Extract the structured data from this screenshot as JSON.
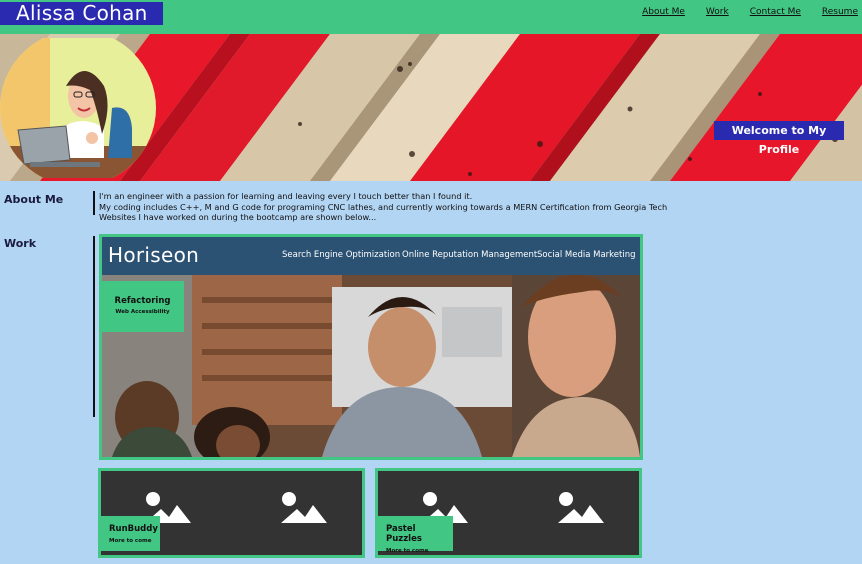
{
  "header": {
    "name": "Alissa Cohan",
    "nav": [
      "About Me",
      "Work",
      "Contact Me",
      "Resume"
    ]
  },
  "hero": {
    "welcome": "Welcome to My Profile"
  },
  "about": {
    "label": "About Me",
    "lines": [
      "I'm an engineer with a passion for learning and leaving every I touch better than I found it.",
      "My coding includes C++, M and G code for programing CNC lathes, and currently working towards a MERN Certification from Georgia Tech",
      "Websites I have worked on during the bootcamp are shown below..."
    ]
  },
  "work": {
    "label": "Work",
    "featured": {
      "site_logo": "Horiseon",
      "site_nav": [
        "Search Engine Optimization",
        "Online Reputation Management",
        "Social Media Marketing"
      ],
      "tag_title": "Refactoring",
      "tag_sub": "Web Accessibility"
    },
    "projects": [
      {
        "title": "RunBuddy",
        "sub": "More to come"
      },
      {
        "title": "Pastel Puzzles",
        "sub": "More to come"
      }
    ]
  },
  "colors": {
    "green": "#42c684",
    "navy": "#2a2ab0",
    "background": "#b3d5f4"
  }
}
